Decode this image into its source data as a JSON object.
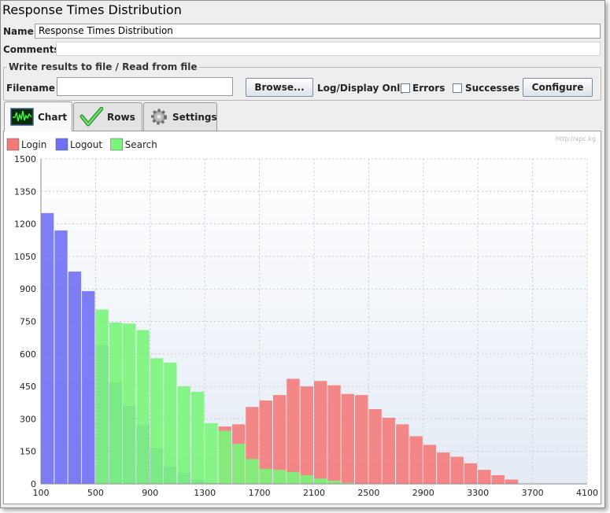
{
  "window": {
    "title": "Response Times Distribution"
  },
  "name": {
    "label": "Name:",
    "value": "Response Times Distribution"
  },
  "comments": {
    "label": "Comments:",
    "value": ""
  },
  "file_group": {
    "title": "Write results to file / Read from file",
    "filename_label": "Filename",
    "filename_value": "",
    "browse_label": "Browse...",
    "log_display_label": "Log/Display Only:",
    "errors_label": "Errors",
    "errors_checked": false,
    "successes_label": "Successes",
    "successes_checked": false,
    "configure_label": "Configure"
  },
  "tabs": [
    {
      "label": "Chart",
      "icon": "chart-icon",
      "active": true
    },
    {
      "label": "Rows",
      "icon": "checkmark-icon",
      "active": false
    },
    {
      "label": "Settings",
      "icon": "gear-icon",
      "active": false
    }
  ],
  "watermark": "http://apc.kg",
  "chart_data": {
    "type": "bar",
    "title": "",
    "xlabel": "",
    "ylabel": "",
    "xlim": [
      100,
      4100
    ],
    "ylim": [
      0,
      1500
    ],
    "bin_width": 100,
    "x_ticks": [
      100,
      500,
      900,
      1300,
      1700,
      2100,
      2500,
      2900,
      3300,
      3700,
      4100
    ],
    "y_ticks": [
      0,
      150,
      300,
      450,
      600,
      750,
      900,
      1050,
      1200,
      1350,
      1500
    ],
    "legend_position": "top-left",
    "grid": true,
    "bins_start": [
      100,
      200,
      300,
      400,
      500,
      600,
      700,
      800,
      900,
      1000,
      1100,
      1200,
      1300,
      1400,
      1500,
      1600,
      1700,
      1800,
      1900,
      2000,
      2100,
      2200,
      2300,
      2400,
      2500,
      2600,
      2700,
      2800,
      2900,
      3000,
      3100,
      3200,
      3300,
      3400,
      3500
    ],
    "series": [
      {
        "name": "Login",
        "color": "#f47a7a",
        "values": [
          0,
          0,
          0,
          0,
          0,
          0,
          0,
          0,
          0,
          0,
          0,
          0,
          0,
          265,
          275,
          355,
          385,
          410,
          485,
          450,
          475,
          455,
          415,
          410,
          345,
          305,
          275,
          220,
          180,
          145,
          125,
          95,
          65,
          40,
          20
        ]
      },
      {
        "name": "Logout",
        "color": "#7070f5",
        "values": [
          1250,
          1170,
          980,
          890,
          640,
          470,
          360,
          270,
          165,
          80,
          50,
          20,
          5,
          0,
          0,
          0,
          0,
          0,
          0,
          0,
          0,
          0,
          0,
          0,
          0,
          0,
          0,
          0,
          0,
          0,
          0,
          0,
          0,
          0,
          0
        ]
      },
      {
        "name": "Search",
        "color": "#7af57a",
        "values": [
          0,
          0,
          0,
          0,
          805,
          745,
          740,
          710,
          580,
          560,
          450,
          425,
          280,
          245,
          185,
          115,
          70,
          65,
          55,
          40,
          25,
          15,
          5,
          0,
          0,
          0,
          0,
          0,
          0,
          0,
          0,
          0,
          0,
          0,
          0
        ]
      }
    ]
  }
}
